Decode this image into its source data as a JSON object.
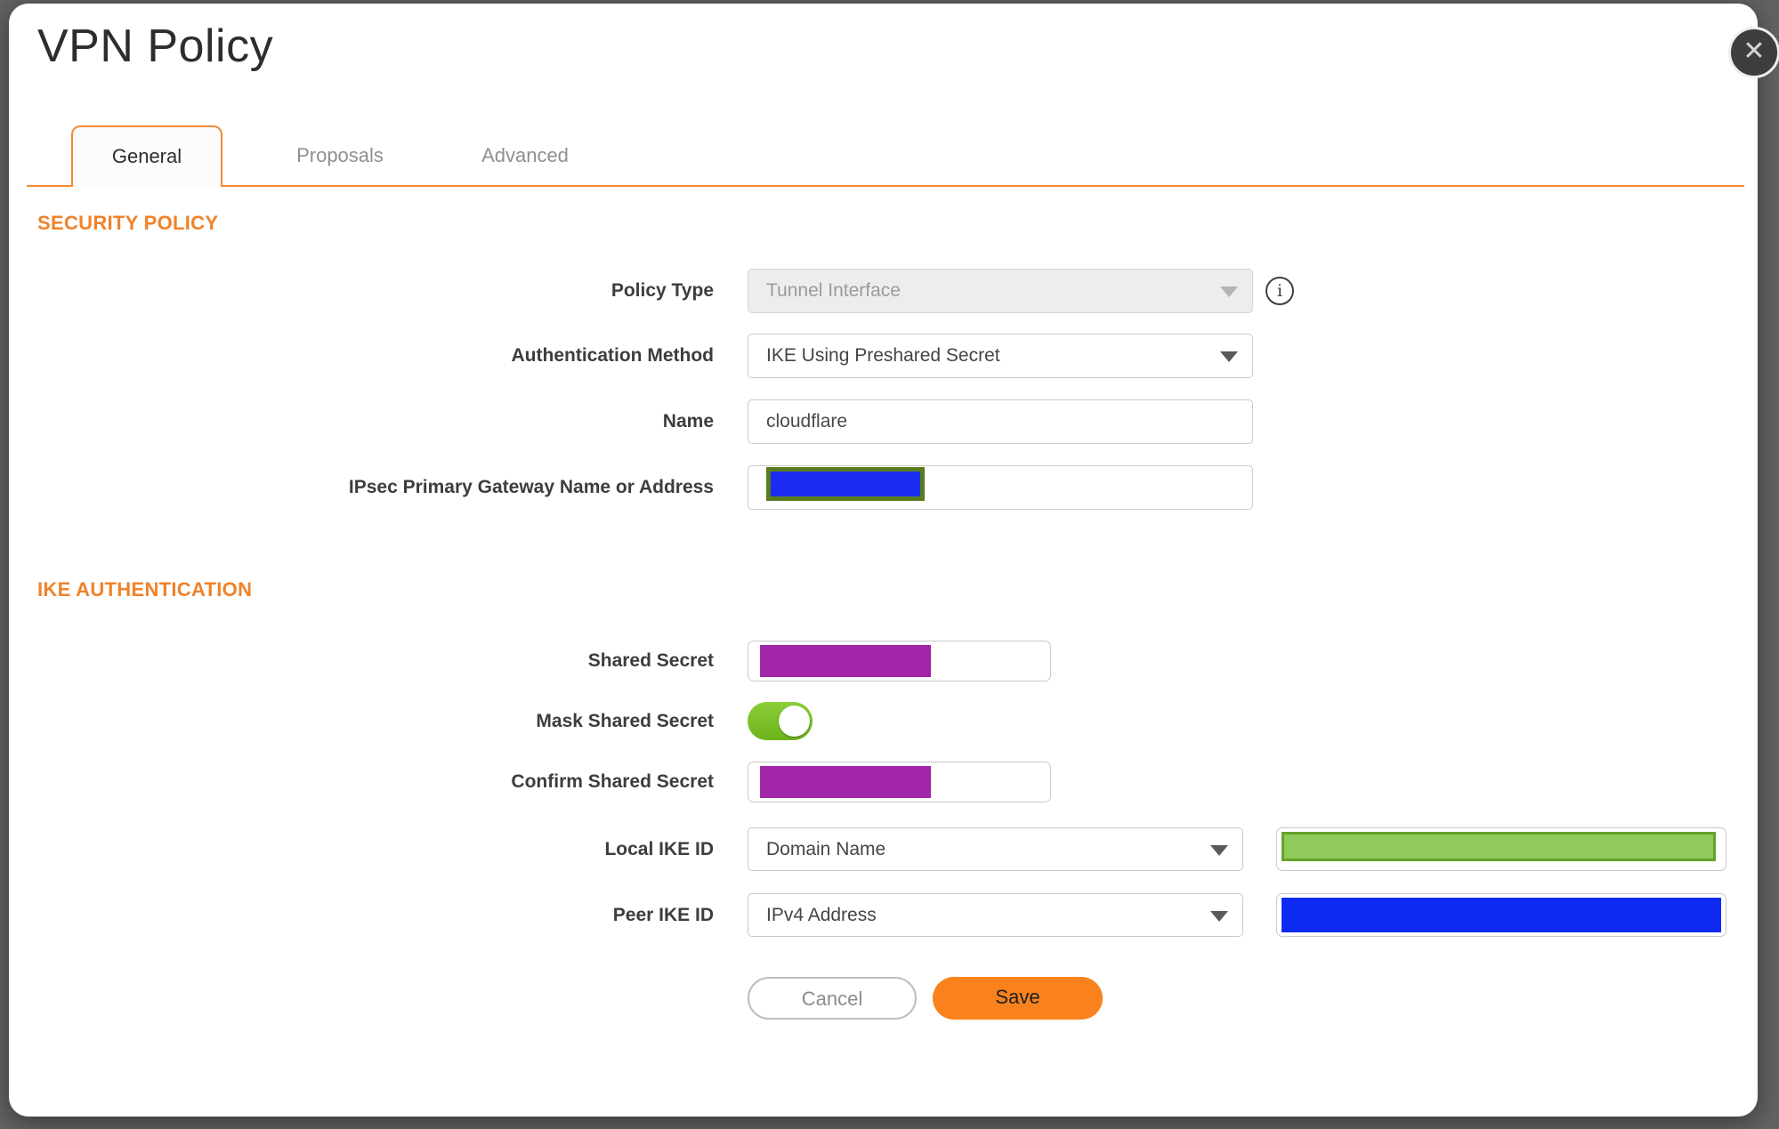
{
  "dialog": {
    "title": "VPN Policy"
  },
  "icons": {
    "close_glyph": "✕",
    "info_glyph": "i"
  },
  "tabs": [
    {
      "label": "General",
      "active": true
    },
    {
      "label": "Proposals",
      "active": false
    },
    {
      "label": "Advanced",
      "active": false
    }
  ],
  "sections": {
    "security_policy": "SECURITY POLICY",
    "ike_authentication": "IKE AUTHENTICATION"
  },
  "fields": {
    "policy_type": {
      "label": "Policy Type",
      "value": "Tunnel Interface",
      "disabled": true
    },
    "authentication_method": {
      "label": "Authentication Method",
      "value": "IKE Using Preshared Secret"
    },
    "name": {
      "label": "Name",
      "value": "cloudflare"
    },
    "ipsec_primary_gateway": {
      "label": "IPsec Primary Gateway Name or Address",
      "value": "",
      "redacted": true,
      "redaction_color": "#1b2cf0",
      "redaction_border": "#577d20"
    },
    "shared_secret": {
      "label": "Shared Secret",
      "value": "",
      "redacted": true,
      "redaction_color": "#a226a8"
    },
    "mask_shared_secret": {
      "label": "Mask Shared Secret",
      "state": "on"
    },
    "confirm_shared_secret": {
      "label": "Confirm Shared Secret",
      "value": "",
      "redacted": true,
      "redaction_color": "#a226a8"
    },
    "local_ike_id": {
      "label": "Local IKE ID",
      "selected": "Domain Name",
      "value": "",
      "redacted": true,
      "redaction_color": "#8fca5a",
      "redaction_border": "#64a32a"
    },
    "peer_ike_id": {
      "label": "Peer IKE ID",
      "selected": "IPv4 Address",
      "value": "",
      "redacted": true,
      "redaction_color": "#0e2bf4"
    }
  },
  "buttons": {
    "cancel": "Cancel",
    "save": "Save"
  },
  "colors": {
    "accent_orange": "#f28b30",
    "section_header_orange": "#f08229",
    "save_button_orange": "#f9821d",
    "toggle_green": "#7cc22b",
    "backdrop_gray": "#636363"
  }
}
